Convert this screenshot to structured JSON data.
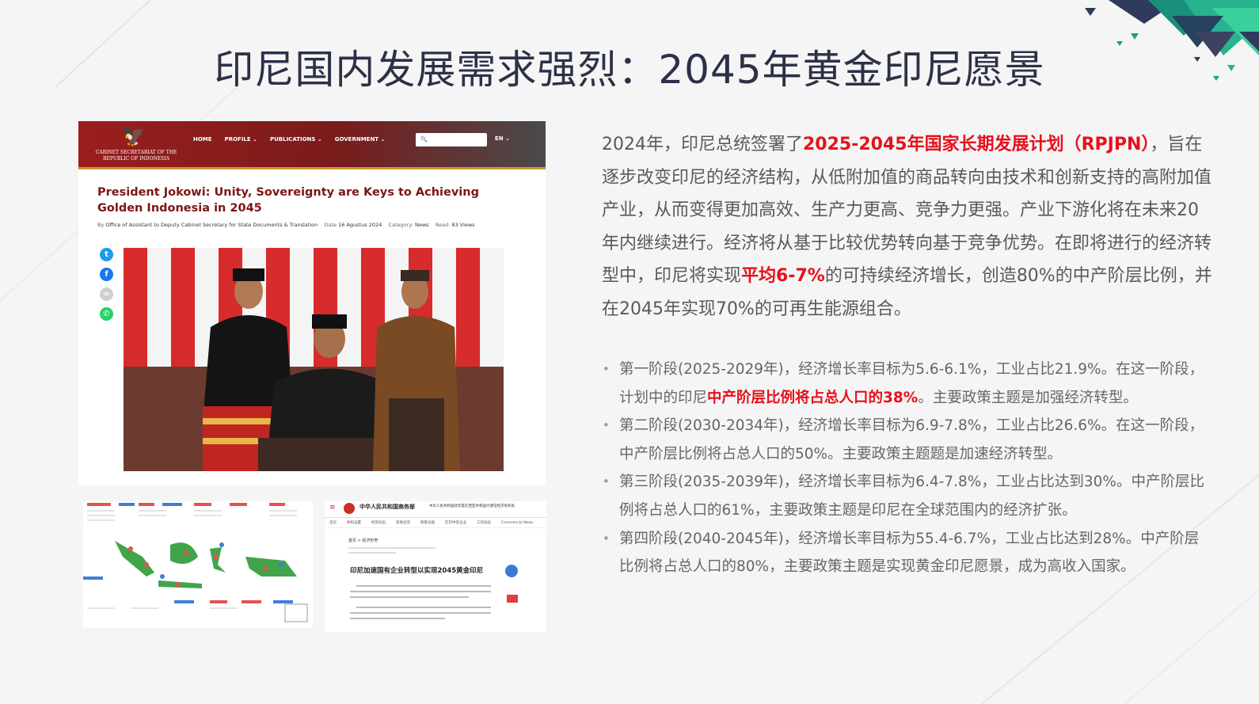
{
  "title": "印尼国内发展需求强烈：2045年黄金印尼愿景",
  "website": {
    "org_name": "CABINET SECRETARIAT OF THE REPUBLIC OF INDONESIA",
    "nav": [
      "HOME",
      "PROFILE ⌄",
      "PUBLICATIONS ⌄",
      "GOVERNMENT ⌄"
    ],
    "lang": "EN ⌄",
    "headline": "President Jokowi: Unity, Sovereignty are Keys to Achieving Golden Indonesia in 2045",
    "byline_prefix": "By",
    "byline": "Office of Assistant to Deputy Cabinet Secretary for State Documents & Translation",
    "date_label": "Date",
    "date": "16 Agustus 2024",
    "category_label": "Category:",
    "category": "News",
    "read_label": "Read:",
    "read": "83 Views",
    "share_icons": [
      "twitter-icon",
      "facebook-icon",
      "link-icon",
      "whatsapp-icon"
    ]
  },
  "doc_page": {
    "ministry": "中华人民共和国商务部",
    "office": "中华人民共和国驻印度尼西亚共和国大使馆经济商务处",
    "nav": [
      "首页",
      "机构设置",
      "经贸动态",
      "贸易投资",
      "政策法规",
      "在印中资企业",
      "工作动态",
      "Commercial News"
    ],
    "crumb": "首页 > 经济形势",
    "headline": "印尼加速国有企业转型以实现2045黄金印尼"
  },
  "intro": {
    "p1": "2024年，印尼总统签署了",
    "h1": "2025-2045年国家长期发展计划（RPJPN）",
    "p2": "，旨在逐步改变印尼的经济结构，从低附加值的商品转向由技术和创新支持的高附加值产业，从而变得更加高效、生产力更高、竞争力更强。产业下游化将在未来20年内继续进行。经济将从基于比较优势转向基于竞争优势。在即将进行的经济转型中，印尼将实现",
    "h2": "平均6-7%",
    "p3": "的可持续经济增长，创造80%的中产阶层比例，并在2045年实现70%的可再生能源组合。"
  },
  "phases": [
    {
      "pre": "第一阶段(2025-2029年)，经济增长率目标为5.6-6.1%，工业占比21.9%。在这一阶段，计划中的印尼",
      "hl": "中产阶层比例将占总人口的38%",
      "post": "。主要政策主题是加强经济转型。"
    },
    {
      "text": "第二阶段(2030-2034年)，经济增长率目标为6.9-7.8%，工业占比26.6%。在这一阶段，中产阶层比例将占总人口的50%。主要政策主题题是加速经济转型。"
    },
    {
      "text": "第三阶段(2035-2039年)，经济增长率目标为6.4-7.8%，工业占比达到30%。中产阶层比例将占总人口的61%，主要政策主题是印尼在全球范围内的经济扩张。"
    },
    {
      "text": "第四阶段(2040-2045年)，经济增长率目标为55.4-6.7%，工业占比达到28%。中产阶层比例将占总人口的80%，主要政策主题是实现黄金印尼愿景，成为高收入国家。"
    }
  ],
  "colors": {
    "title": "#2d3147",
    "highlight": "#e8101a",
    "header_red": "#9b1e1e",
    "teal": "#1fa088"
  }
}
